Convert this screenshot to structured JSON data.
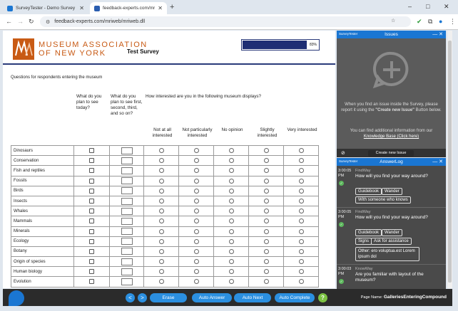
{
  "browser": {
    "tabs": [
      {
        "title": "SurveyTester - Demo Survey 1",
        "active": false,
        "favicon_color": "#1a76d2"
      },
      {
        "title": "feedback-experts.com/mriweb",
        "active": true,
        "favicon_color": "#2a5db0"
      }
    ],
    "new_tab": "+",
    "window_controls": {
      "minimize": "–",
      "maximize": "□",
      "close": "✕"
    },
    "url": "feedback-experts.com/mriweb/mriweb.dll"
  },
  "survey": {
    "org_line1": "MUSEUM ASSOCIATION",
    "org_line2": "OF NEW YORK",
    "title": "Test Survey",
    "progress_percent": 83,
    "progress_label": "83%",
    "intro": "Questions for respondents entering the museum",
    "col1_header": "What do you plan to see today?",
    "col2_header": "What do you plan to see first, second, third, and so on?",
    "interest_header": "How interested are you in the following museum displays?",
    "interest_options": [
      "Not at all interested",
      "Not particularly interested",
      "No opinion",
      "Slightly interested",
      "Very interested"
    ],
    "rows": [
      "Dinosaurs",
      "Conservation",
      "Fish and reptiles",
      "Fossils",
      "Birds",
      "Insects",
      "Whales",
      "Mammals",
      "Minerals",
      "Ecology",
      "Botany",
      "Origin of species",
      "Human biology",
      "Evolution"
    ]
  },
  "issues_panel": {
    "brand": "SurveyTester",
    "title": "Issues",
    "text1a": "When you find an issue inside the Survey, please report it using the ",
    "text1b": "\"Create new Issue\"",
    "text1c": " Button below.",
    "text2a": "You can find additional information from our ",
    "text2b": "Knowledge Base (Click here)",
    "new_issue_label": "Create new Issue"
  },
  "answer_log": {
    "brand": "SurveyTester",
    "title": "AnswerLog",
    "entries": [
      {
        "time": "3:00:05",
        "ampm": "PM",
        "name": "FindWay",
        "question": "How will you find your way around?",
        "answers": [
          "Guidebook",
          "Wander",
          "With someone who knows"
        ]
      },
      {
        "time": "3:00:05",
        "ampm": "PM",
        "name": "FindWay",
        "question": "How will you find your way around?",
        "answers": [
          "Guidebook",
          "Wander",
          "Signs",
          "Ask for assistance"
        ],
        "other": "Other: ero voluptua.est Lorem ipsum dol"
      },
      {
        "time": "3:00:03",
        "ampm": "PM",
        "name": "KnowWay",
        "question": "Are you familiar with layout of the museum?",
        "answers": []
      }
    ]
  },
  "bottom_bar": {
    "prev": "<",
    "next": ">",
    "erase": "Erase",
    "auto_answer": "Auto Answer",
    "auto_next": "Auto Next",
    "auto_complete": "Auto Complete",
    "help": "?",
    "page_name_label": "Page Name:",
    "page_name": "GalleriesEnteringCompound"
  },
  "colors": {
    "accent": "#1a76d2",
    "survey_navy": "#1e2e74",
    "museum_orange": "#c85a14",
    "help_green": "#7cc242"
  }
}
